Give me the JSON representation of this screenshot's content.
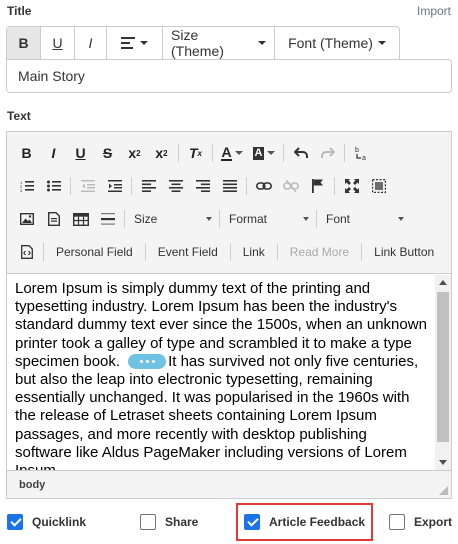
{
  "title_section": {
    "label": "Title",
    "import_link": "Import",
    "toolbar": {
      "bold": "B",
      "underline": "U",
      "italic": "I",
      "size_label": "Size (Theme)",
      "font_label": "Font (Theme)"
    },
    "input_value": "Main Story"
  },
  "text_section": {
    "label": "Text",
    "toolbar": {
      "size_combo": "Size",
      "format_combo": "Format",
      "font_combo": "Font",
      "personal_field": "Personal Field",
      "event_field": "Event Field",
      "link": "Link",
      "read_more": "Read More",
      "link_button": "Link Button"
    },
    "content_before": "Lorem Ipsum is simply dummy text of the printing and typesetting industry. Lorem Ipsum has been the industry's standard dummy text ever since the 1500s, when an unknown printer took a galley of type and scrambled it to make a type specimen book.",
    "content_after": "It has survived not only five centuries, but also the leap into electronic typesetting, remaining essentially unchanged. It was popularised in the 1960s with the release of Letraset sheets containing Lorem Ipsum passages, and more recently with desktop publishing software like Aldus PageMaker including versions of Lorem Ipsum.",
    "status_path": "body"
  },
  "options": [
    {
      "label": "Quicklink",
      "checked": true
    },
    {
      "label": "Share",
      "checked": false
    },
    {
      "label": "Article Feedback",
      "checked": true
    },
    {
      "label": "Export",
      "checked": false
    }
  ],
  "colors": {
    "checkbox_checked": "#1a73e8",
    "highlight_border": "#e53935",
    "ellipsis_chip": "#6fc2e2"
  }
}
